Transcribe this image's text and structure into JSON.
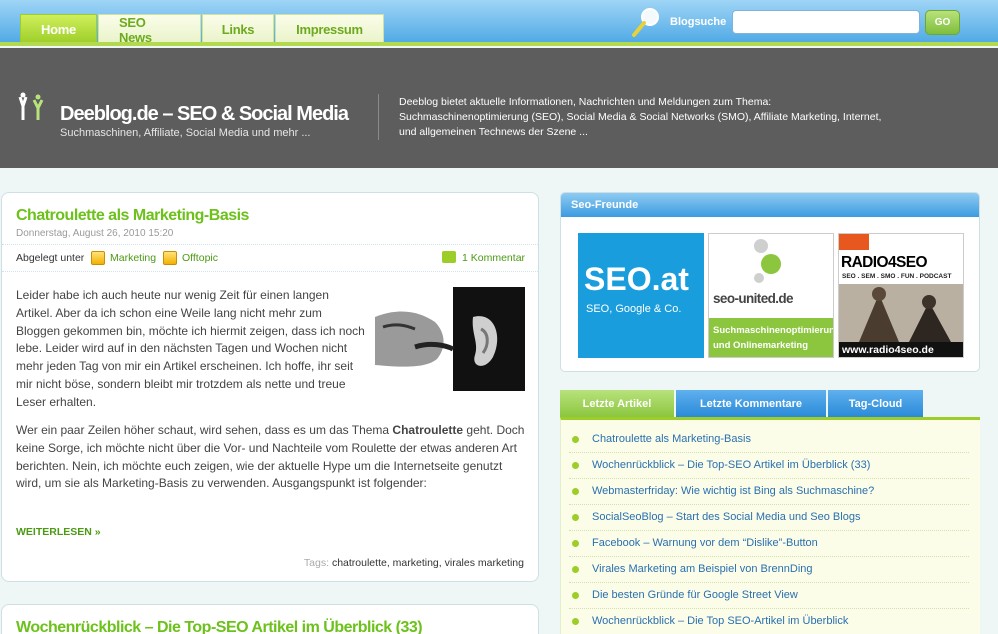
{
  "nav": {
    "tabs": [
      {
        "label": "Home"
      },
      {
        "label": "SEO News"
      },
      {
        "label": "Links"
      },
      {
        "label": "Impressum"
      }
    ]
  },
  "search": {
    "label": "Blogsuche",
    "value": "",
    "button": "GO"
  },
  "header": {
    "title": "Deeblog.de – SEO & Social Media",
    "tagline": "Suchmaschinen, Affiliate, Social Media und mehr ...",
    "description": "Deeblog bietet aktuelle Informationen, Nachrichten und Meldungen zum Thema: Suchmaschinenoptimierung (SEO), Social Media & Social Networks (SMO), Affiliate Marketing, Internet, und allgemeinen Technews der Szene ..."
  },
  "posts": [
    {
      "title": "Chatroulette als Marketing-Basis",
      "date": "Donnerstag, August 26, 2010 15:20",
      "meta_prefix": "Abgelegt unter",
      "categories": [
        "Marketing",
        "Offtopic"
      ],
      "comments": "1 Kommentar",
      "para1": "Leider habe ich auch heute nur wenig Zeit für einen langen Artikel. Aber da ich schon eine Weile lang nicht mehr zum Bloggen gekommen bin, möchte ich hiermit zeigen, dass ich noch lebe. Leider wird auf in den nächsten Tagen und Wochen nicht mehr jeden Tag von mir ein Artikel erscheinen. Ich hoffe, ihr seit mir nicht böse, sondern bleibt mir trotzdem als nette und treue Leser erhalten.",
      "para2_before": "Wer ein paar Zeilen höher schaut, wird sehen, dass es um das Thema ",
      "para2_bold": "Chatroulette",
      "para2_after": " geht. Doch keine Sorge, ich möchte nicht über die Vor- und Nachteile vom Roulette der etwas anderen Art berichten. Nein, ich möchte euch zeigen, wie der aktuelle Hype um die Internetseite genutzt wird, um sie als Marketing-Basis zu verwenden. Ausgangspunkt ist folgender:",
      "read_more": "WEITERLESEN »",
      "tags_label": "Tags:",
      "tags": [
        "chatroulette",
        "marketing",
        "virales marketing"
      ]
    },
    {
      "title": "Wochenrückblick – Die Top-SEO Artikel im Überblick (33)"
    }
  ],
  "sidebar": {
    "friends_title": "Seo-Freunde",
    "banners": [
      {
        "line1": "SEO.at",
        "line2": "SEO, Google & Co."
      },
      {
        "line1": "seo-united.de",
        "line2": "Suchmaschinenoptimierung und Onlinemarketing"
      },
      {
        "line1": "RADIO4SEO",
        "line2": "SEO . SEM . SMO . FUN . PODCAST",
        "line3": "www.radio4seo.de"
      }
    ],
    "tabs": [
      {
        "label": "Letzte Artikel"
      },
      {
        "label": "Letzte Kommentare"
      },
      {
        "label": "Tag-Cloud"
      }
    ],
    "articles": [
      "Chatroulette als Marketing-Basis",
      "Wochenrückblick – Die Top-SEO Artikel im Überblick (33)",
      "Webmasterfriday: Wie wichtig ist Bing als Suchmaschine?",
      "SocialSeoBlog – Start des Social Media und Seo Blogs",
      "Facebook – Warnung vor dem “Dislike”-Button",
      "Virales Marketing am Beispiel von BrennDing",
      "Die besten Gründe für Google Street View",
      "Wochenrückblick – Die Top SEO-Artikel im Überblick"
    ]
  },
  "colors": {
    "accent_green": "#6cc11a",
    "nav_blue": "#4aa6e4",
    "header_gray": "#5d5d5d",
    "link_blue": "#2a6fb0"
  }
}
